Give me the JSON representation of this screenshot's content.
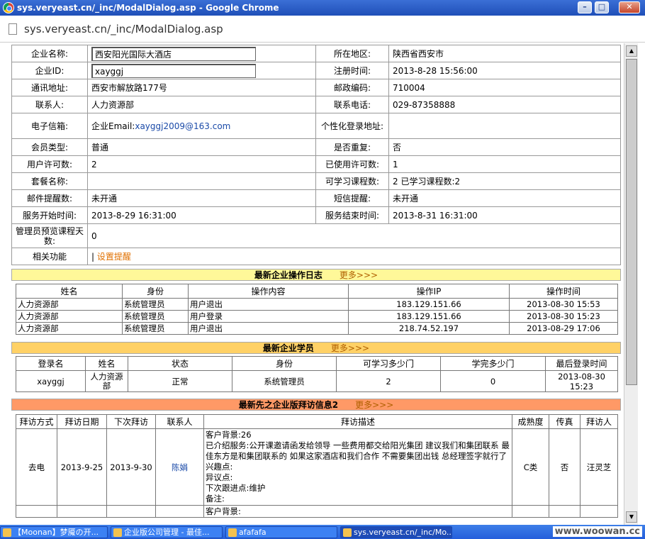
{
  "window": {
    "title": "sys.veryeast.cn/_inc/ModalDialog.asp - Google Chrome",
    "url": "sys.veryeast.cn/_inc/ModalDialog.asp",
    "min": "–",
    "max": "□",
    "close": "✕"
  },
  "info": {
    "company_name_label": "企业名称:",
    "company_name": "西安阳光国际大酒店",
    "region_label": "所在地区:",
    "region": "陕西省西安市",
    "company_id_label": "企业ID:",
    "company_id": "xayggj",
    "reg_time_label": "注册时间:",
    "reg_time": "2013-8-28 15:56:00",
    "address_label": "通讯地址:",
    "address": "西安市解放路177号",
    "zip_label": "邮政编码:",
    "zip": "710004",
    "contact_label": "联系人:",
    "contact": "人力资源部",
    "phone_label": "联系电话:",
    "phone": "029-87358888",
    "email_label": "电子信箱:",
    "email_prefix": "企业Email:",
    "email": "xayggj2009@163.com",
    "custom_login_label": "个性化登录地址:",
    "custom_login": "",
    "member_type_label": "会员类型:",
    "member_type": "普通",
    "duplicate_label": "是否重复:",
    "duplicate": "否",
    "user_license_label": "用户许可数:",
    "user_license": "2",
    "used_license_label": "已使用许可数:",
    "used_license": "1",
    "package_label": "套餐名称:",
    "package": "",
    "courses_label": "可学习课程数:",
    "courses": "2  已学习课程数:2",
    "mail_remind_label": "邮件提醒数:",
    "mail_remind": "未开通",
    "sms_remind_label": "短信提醒:",
    "sms_remind": "未开通",
    "start_label": "服务开始时间:",
    "start": "2013-8-29 16:31:00",
    "end_label": "服务结束时间:",
    "end": "2013-8-31 16:31:00",
    "admin_preview_label": "管理员预览课程天数:",
    "admin_preview": "0",
    "related_label": "相关功能",
    "related_sep": "|",
    "related_link": "设置提醒"
  },
  "log": {
    "title": "最新企业操作日志",
    "more": "更多>>>",
    "headers": [
      "姓名",
      "身份",
      "操作内容",
      "操作IP",
      "操作时间"
    ],
    "rows": [
      [
        "人力资源部",
        "系统管理员",
        "用户退出",
        "183.129.151.66",
        "2013-08-30 15:53"
      ],
      [
        "人力资源部",
        "系统管理员",
        "用户登录",
        "183.129.151.66",
        "2013-08-30 15:23"
      ],
      [
        "人力资源部",
        "系统管理员",
        "用户退出",
        "218.74.52.197",
        "2013-08-29 17:06"
      ]
    ]
  },
  "students": {
    "title": "最新企业学员",
    "more": "更多>>>",
    "headers": [
      "登录名",
      "姓名",
      "状态",
      "身份",
      "可学习多少门",
      "学完多少门",
      "最后登录时间"
    ],
    "row": [
      "xayggj",
      "人力资源部",
      "正常",
      "系统管理员",
      "2",
      "0",
      "2013-08-30 15:23"
    ]
  },
  "visits": {
    "title": "最新先之企业版拜访信息2",
    "more": "更多>>>",
    "headers": [
      "拜访方式",
      "拜访日期",
      "下次拜访",
      "联系人",
      "拜访描述",
      "成熟度",
      "传真",
      "拜访人"
    ],
    "row": {
      "method": "去电",
      "date": "2013-9-25",
      "next": "2013-9-30",
      "contact": "陈娟",
      "desc": [
        "客户背景:26",
        "已介绍服务:公开课邀请函发给领导 一些费用都交给阳光集团 建议我们和集团联系 最佳东方是和集团联系的 如果这家酒店和我们合作 不需要集团出钱 总经理签字就行了",
        "兴趣点:",
        "异议点:",
        "下次跟进点:维护",
        "备注:"
      ],
      "maturity": "C类",
      "fax": "否",
      "visitor": "汪灵芝"
    },
    "next_desc": "客户背景:"
  },
  "taskbar": [
    "【Moonan】梦魇の开...",
    "企业版公司管理 - 最佳...",
    "afafafa",
    "sys.veryeast.cn/_inc/Mo..."
  ],
  "watermark": "www.woowan.cc"
}
